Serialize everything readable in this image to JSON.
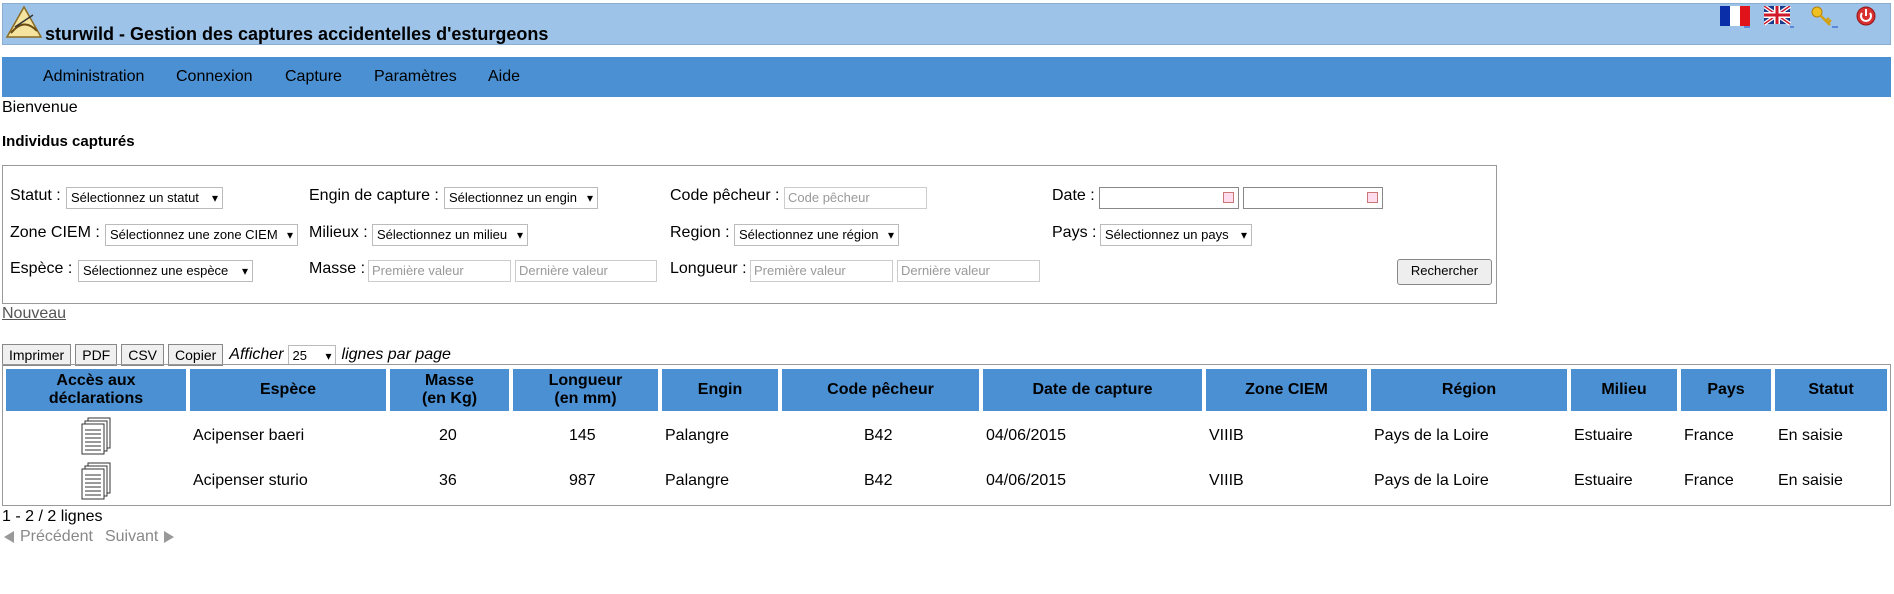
{
  "header": {
    "title": "sturwild - Gestion des captures accidentelles d'esturgeons",
    "icons": [
      "flag-fr-icon",
      "flag-uk-icon",
      "key-icon",
      "power-icon"
    ]
  },
  "menu": {
    "items": [
      "Administration",
      "Connexion",
      "Capture",
      "Paramètres",
      "Aide"
    ]
  },
  "welcome": "Bienvenue",
  "section_title": "Individus capturés",
  "filters": {
    "statut_label": "Statut :",
    "statut_value": "Sélectionnez un statut",
    "engin_label": "Engin de capture :",
    "engin_value": "Sélectionnez un engin",
    "code_label": "Code pêcheur :",
    "code_placeholder": "Code pêcheur",
    "date_label": "Date :",
    "zone_label": "Zone CIEM :",
    "zone_value": "Sélectionnez une zone CIEM",
    "milieux_label": "Milieux :",
    "milieux_value": "Sélectionnez un milieu",
    "region_label": "Region :",
    "region_value": "Sélectionnez une région",
    "pays_label": "Pays :",
    "pays_value": "Sélectionnez un pays",
    "espece_label": "Espèce :",
    "espece_value": "Sélectionnez une espèce",
    "masse_label": "Masse :",
    "masse_first": "Première valeur",
    "masse_last": "Dernière valeur",
    "longueur_label": "Longueur :",
    "longueur_first": "Première valeur",
    "longueur_last": "Dernière valeur",
    "search_button": "Rechercher"
  },
  "new_link": "Nouveau",
  "toolbar": {
    "print": "Imprimer",
    "pdf": "PDF",
    "csv": "CSV",
    "copy": "Copier",
    "afficher": "Afficher",
    "lines_value": "25",
    "lines_label": "lignes par page"
  },
  "table": {
    "headers": {
      "acces_1": "Accès aux",
      "acces_2": "déclarations",
      "espece": "Espèce",
      "masse_1": "Masse",
      "masse_2": "(en Kg)",
      "longueur_1": "Longueur",
      "longueur_2": "(en mm)",
      "engin": "Engin",
      "code": "Code pêcheur",
      "date": "Date de capture",
      "zone": "Zone CIEM",
      "region": "Région",
      "milieu": "Milieu",
      "pays": "Pays",
      "statut": "Statut"
    },
    "rows": [
      {
        "espece": "Acipenser baeri",
        "masse": "20",
        "longueur": "145",
        "engin": "Palangre",
        "code": "B42",
        "date": "04/06/2015",
        "zone": "VIIIB",
        "region": "Pays de la Loire",
        "milieu": "Estuaire",
        "pays": "France",
        "statut": "En saisie"
      },
      {
        "espece": "Acipenser sturio",
        "masse": "36",
        "longueur": "987",
        "engin": "Palangre",
        "code": "B42",
        "date": "04/06/2015",
        "zone": "VIIIB",
        "region": "Pays de la Loire",
        "milieu": "Estuaire",
        "pays": "France",
        "statut": "En saisie"
      }
    ]
  },
  "footer": {
    "count": "1 - 2 / 2 lignes",
    "prev": "Précédent",
    "next": "Suivant"
  }
}
